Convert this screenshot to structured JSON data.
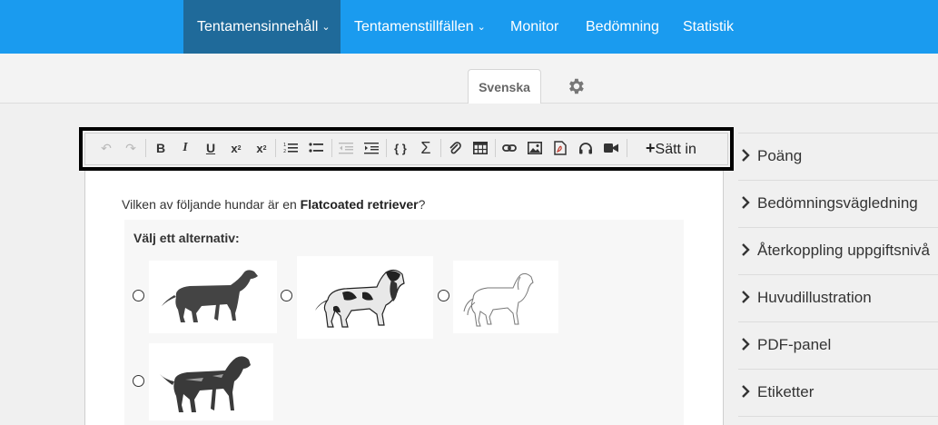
{
  "nav": {
    "items": [
      {
        "label": "Tentamensinnehåll",
        "dropdown": true,
        "active": true
      },
      {
        "label": "Tentamenstillfällen",
        "dropdown": true,
        "active": false
      },
      {
        "label": "Monitor",
        "dropdown": false,
        "active": false
      },
      {
        "label": "Bedömning",
        "dropdown": false,
        "active": false
      },
      {
        "label": "Statistik",
        "dropdown": false,
        "active": false
      }
    ]
  },
  "language": {
    "tab_label": "Svenska",
    "settings_icon": "gear-icon"
  },
  "toolbar": {
    "insert_label": "Sätt in",
    "insert_icon": "plus-icon",
    "icons": [
      "undo-icon",
      "redo-icon",
      "bold-icon",
      "italic-icon",
      "underline-icon",
      "subscript-icon",
      "superscript-icon",
      "ordered-list-icon",
      "bullet-list-icon",
      "outdent-icon",
      "indent-icon",
      "code-icon",
      "sum-icon",
      "attachment-icon",
      "table-icon",
      "link-icon",
      "image-icon",
      "pdf-icon",
      "audio-icon",
      "video-icon"
    ]
  },
  "question": {
    "prefix": "Vilken av följande hundar är en ",
    "emphasis": "Flatcoated retriever",
    "suffix": "?",
    "choices_heading": "Välj ett alternativ:",
    "choices": [
      {
        "image": "black-retriever-dog"
      },
      {
        "image": "spaniel-dog"
      },
      {
        "image": "golden-retriever-dog"
      },
      {
        "image": "rottweiler-dog"
      }
    ]
  },
  "sidebar": {
    "items": [
      {
        "label": "Poäng"
      },
      {
        "label": "Bedömningsvägledning"
      },
      {
        "label": "Återkoppling uppgiftsnivå"
      },
      {
        "label": "Huvudillustration"
      },
      {
        "label": "PDF-panel"
      },
      {
        "label": "Etiketter"
      }
    ]
  },
  "colors": {
    "nav_bg": "#1a9bef",
    "nav_active": "#1f6a9a"
  }
}
